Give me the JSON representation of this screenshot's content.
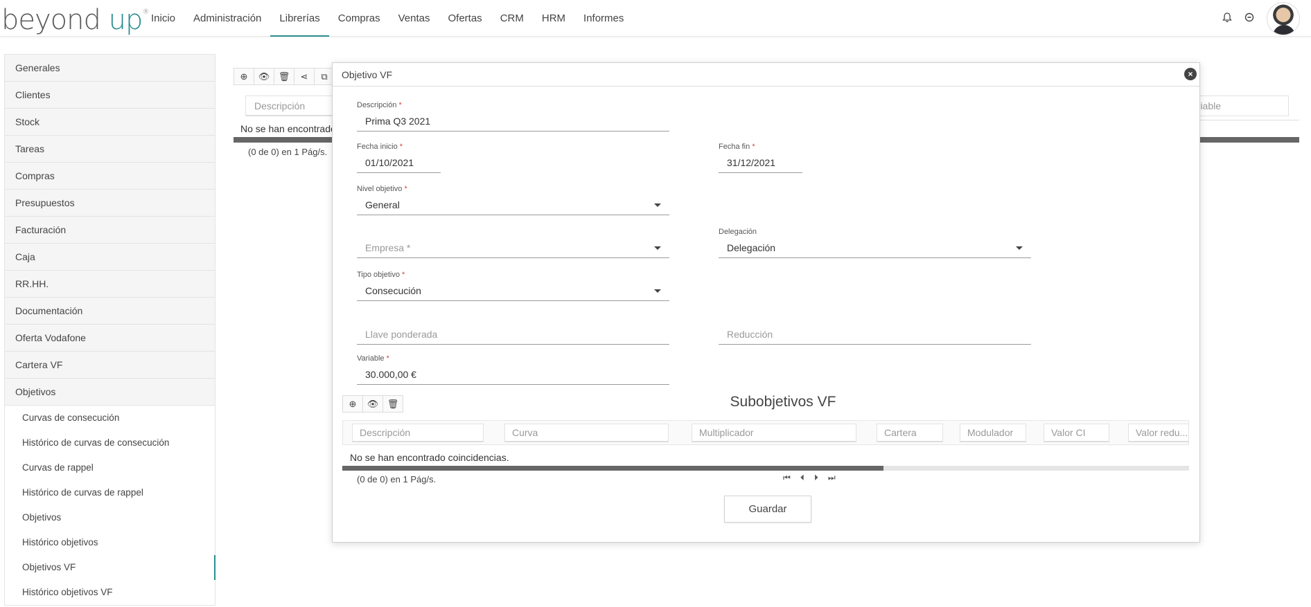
{
  "logo": {
    "brand": "beyond",
    "brand_up": "up",
    "reg": "®"
  },
  "nav": [
    "Inicio",
    "Administración",
    "Librerías",
    "Compras",
    "Ventas",
    "Ofertas",
    "CRM",
    "HRM",
    "Informes"
  ],
  "nav_active": "Librerías",
  "top_icons": {
    "bell": "bell-icon",
    "status": "minus-circle-icon"
  },
  "sidebar": {
    "items": [
      "Generales",
      "Clientes",
      "Stock",
      "Tareas",
      "Compras",
      "Presupuestos",
      "Facturación",
      "Caja",
      "RR.HH.",
      "Documentación",
      "Oferta Vodafone",
      "Cartera VF",
      "Objetivos"
    ],
    "subitems": [
      "Curvas de consecución",
      "Histórico de curvas de consecución",
      "Curvas de rappel",
      "Histórico de curvas de rappel",
      "Objetivos",
      "Histórico objetivos",
      "Objetivos VF",
      "Histórico objetivos VF"
    ],
    "active_subitem": "Objetivos VF"
  },
  "background": {
    "filter_placeholder": "Descripción",
    "filter_right_placeholder": "ariable",
    "empty_text": "No se han encontrado",
    "pagination": "(0 de 0) en 1 Pág/s."
  },
  "modal": {
    "title": "Objetivo VF",
    "close": "×",
    "fields": {
      "descripcion": {
        "label": "Descripción",
        "value": "Prima Q3 2021"
      },
      "fecha_inicio": {
        "label": "Fecha inicio",
        "value": "01/10/2021"
      },
      "fecha_fin": {
        "label": "Fecha fin",
        "value": "31/12/2021"
      },
      "nivel_objetivo": {
        "label": "Nivel objetivo",
        "value": "General"
      },
      "delegacion": {
        "label": "Delegación",
        "value": "Delegación"
      },
      "empresa": {
        "placeholder": "Empresa"
      },
      "tipo_objetivo": {
        "label": "Tipo objetivo",
        "value": "Consecución"
      },
      "llave_ponderada": {
        "placeholder": "Llave ponderada"
      },
      "reduccion": {
        "placeholder": "Reducción"
      },
      "variable": {
        "label": "Variable",
        "value": "30.000,00 €"
      }
    },
    "required_mark": "*",
    "sub_title": "Subobjetivos VF",
    "sub_filters": [
      "Descripción",
      "Curva",
      "Multiplicador",
      "Cartera",
      "Modulador",
      "Valor CI",
      "Valor redu..."
    ],
    "sub_empty": "No se han encontrado coincidencias.",
    "sub_pagination": "(0 de 0) en 1 Pág/s.",
    "sub_scroll_fraction": 0.64,
    "pager": [
      "⏮",
      "⏴",
      "⏵",
      "⏭"
    ],
    "save_label": "Guardar"
  },
  "colors": {
    "accent": "#2a8d8f",
    "required": "#d04545"
  }
}
